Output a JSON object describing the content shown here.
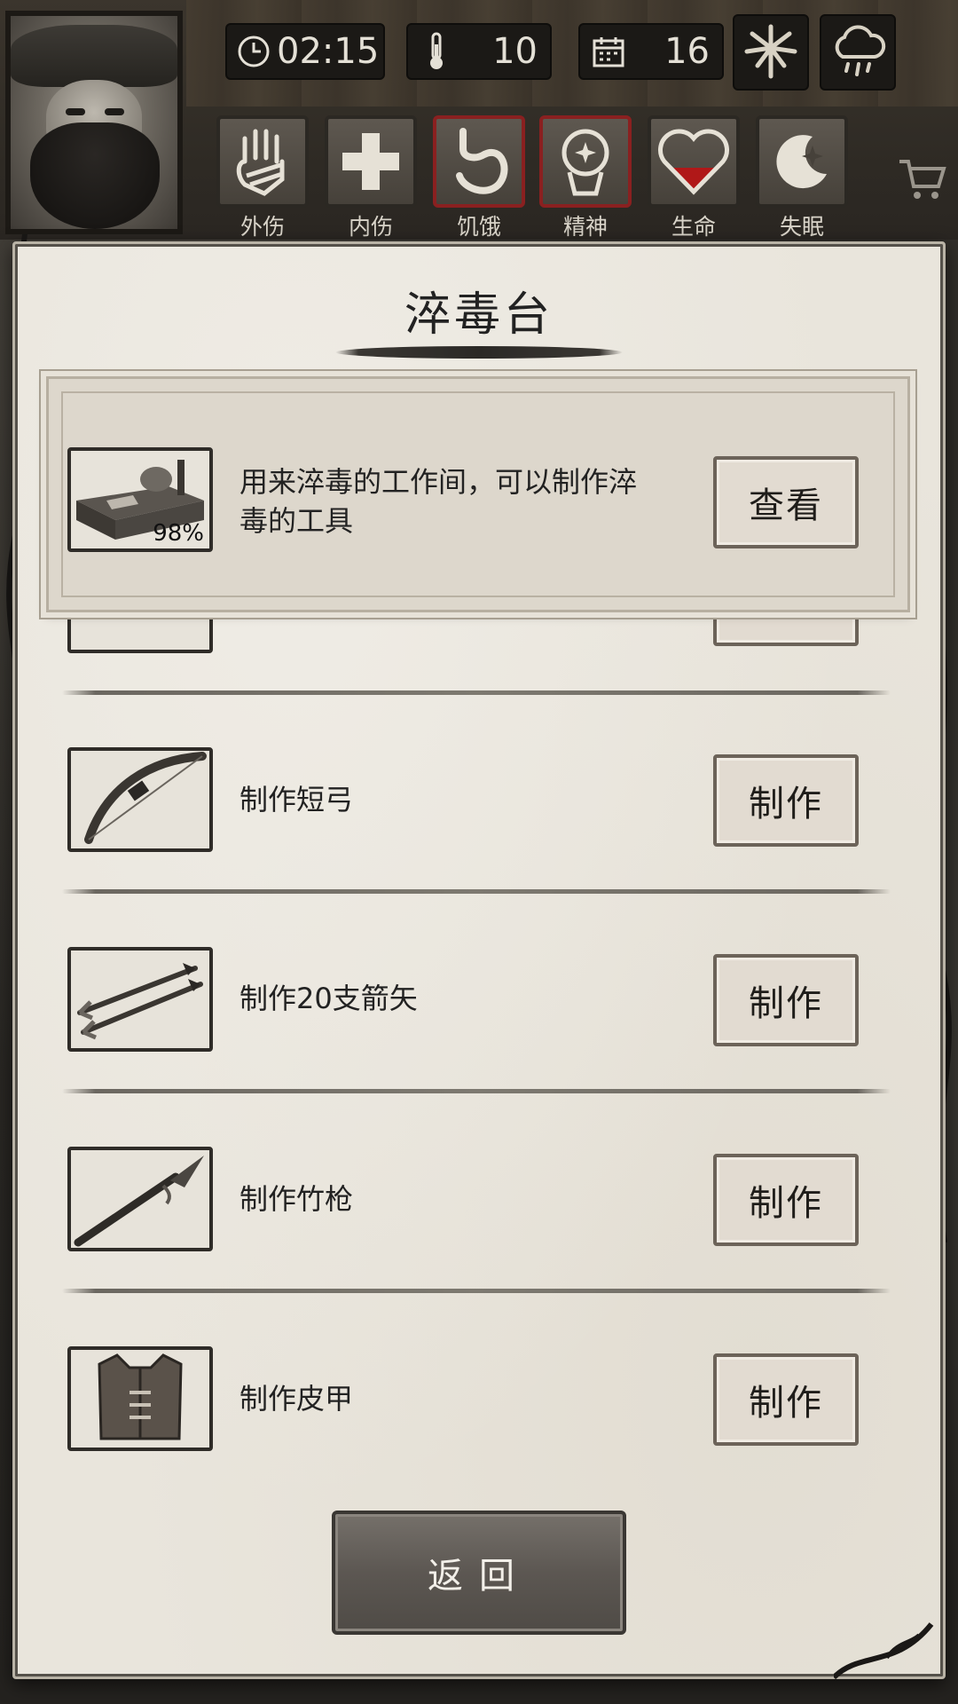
{
  "hud": {
    "time": "02:15",
    "temperature": "10",
    "day": "16",
    "season_icon": "leaf-icon",
    "weather_icon": "rain-cloud-icon"
  },
  "status_bar": [
    {
      "label": "外伤",
      "icon": "hand-bandage-icon",
      "alert": false
    },
    {
      "label": "内伤",
      "icon": "cross-icon",
      "alert": false
    },
    {
      "label": "饥饿",
      "icon": "stomach-icon",
      "alert": true
    },
    {
      "label": "精神",
      "icon": "head-sparkle-icon",
      "alert": true
    },
    {
      "label": "生命",
      "icon": "heart-icon",
      "alert": false,
      "level": 0.45
    },
    {
      "label": "失眠",
      "icon": "moon-star-icon",
      "alert": false
    }
  ],
  "panel": {
    "title": "淬毒台",
    "header": {
      "description_line1": "用来淬毒的工作间，可以制作淬",
      "description_line2": "毒的工具",
      "progress_label": "98%",
      "button": "查看"
    },
    "recipes": [
      {
        "label": "制作短弓",
        "button": "制作",
        "icon": "bow-icon"
      },
      {
        "label": "制作20支箭矢",
        "button": "制作",
        "icon": "arrows-icon"
      },
      {
        "label": "制作竹枪",
        "button": "制作",
        "icon": "spear-icon"
      },
      {
        "label": "制作皮甲",
        "button": "制作",
        "icon": "leather-vest-icon"
      }
    ],
    "back_button": "返回"
  },
  "colors": {
    "alert_border": "#8a2020",
    "heart_fill": "#b01818",
    "paper": "#e9e5dc"
  }
}
